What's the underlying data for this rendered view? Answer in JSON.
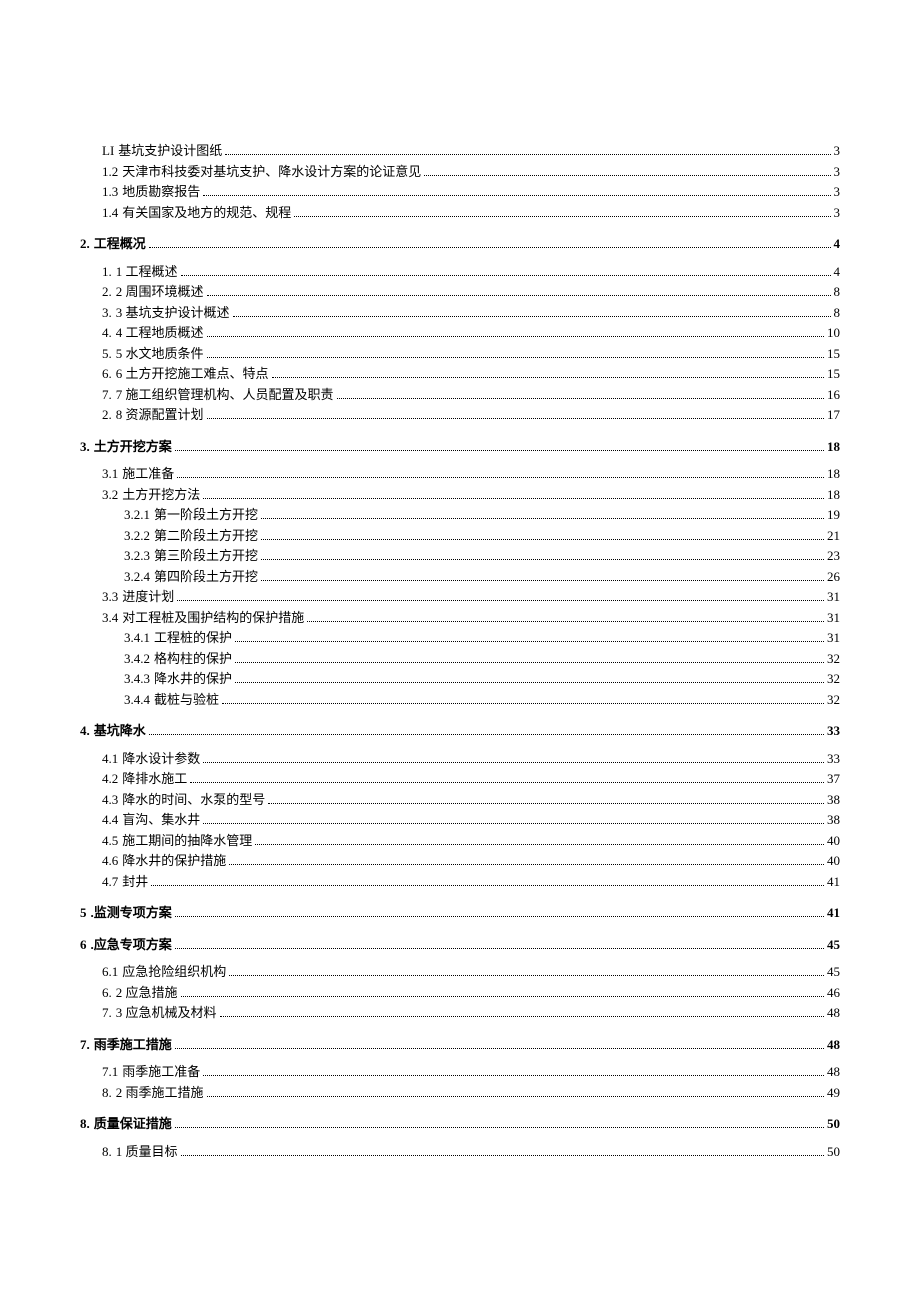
{
  "toc": [
    {
      "level": 2,
      "num": "LI",
      "label": "基坑支护设计图纸",
      "page": "3"
    },
    {
      "level": 2,
      "num": "1.2",
      "label": "天津市科技委对基坑支护、降水设计方案的论证意见",
      "page": "3"
    },
    {
      "level": 2,
      "num": "1.3",
      "label": "地质勘察报告",
      "page": "3"
    },
    {
      "level": 2,
      "num": "1.4",
      "label": "有关国家及地方的规范、规程",
      "page": "3"
    },
    {
      "level": 1,
      "num": "2.",
      "label": "工程概况",
      "page": "4"
    },
    {
      "level": 2,
      "num": "1.",
      "label": "1 工程概述",
      "page": "4"
    },
    {
      "level": 2,
      "num": "2.",
      "label": "2 周围环境概述",
      "page": "8"
    },
    {
      "level": 2,
      "num": "3.",
      "label": "3 基坑支护设计概述",
      "page": "8"
    },
    {
      "level": 2,
      "num": "4.",
      "label": "4 工程地质概述",
      "page": "10"
    },
    {
      "level": 2,
      "num": "5.",
      "label": "5 水文地质条件",
      "page": "15"
    },
    {
      "level": 2,
      "num": "6.",
      "label": "6 土方开挖施工难点、特点",
      "page": "15"
    },
    {
      "level": 2,
      "num": "7.",
      "label": "7 施工组织管理机构、人员配置及职责",
      "page": "16"
    },
    {
      "level": 2,
      "num": "2.",
      "label": "8 资源配置计划",
      "page": "17"
    },
    {
      "level": 1,
      "num": "3.",
      "label": "土方开挖方案",
      "page": "18"
    },
    {
      "level": 2,
      "num": "3.1",
      "label": "施工准备",
      "page": "18"
    },
    {
      "level": 2,
      "num": "3.2",
      "label": "土方开挖方法",
      "page": "18"
    },
    {
      "level": 3,
      "num": "3.2.1",
      "label": "第一阶段土方开挖",
      "page": "19"
    },
    {
      "level": 3,
      "num": "3.2.2",
      "label": "第二阶段土方开挖",
      "page": "21"
    },
    {
      "level": 3,
      "num": "3.2.3",
      "label": "第三阶段土方开挖",
      "page": "23"
    },
    {
      "level": 3,
      "num": "3.2.4",
      "label": "第四阶段土方开挖",
      "page": "26"
    },
    {
      "level": 2,
      "num": "3.3",
      "label": "进度计划",
      "page": "31"
    },
    {
      "level": 2,
      "num": "3.4",
      "label": "对工程桩及围护结构的保护措施",
      "page": "31"
    },
    {
      "level": 3,
      "num": "3.4.1",
      "label": "工程桩的保护",
      "page": "31"
    },
    {
      "level": 3,
      "num": "3.4.2",
      "label": "格构柱的保护",
      "page": "32"
    },
    {
      "level": 3,
      "num": "3.4.3",
      "label": "降水井的保护",
      "page": "32"
    },
    {
      "level": 3,
      "num": "3.4.4",
      "label": "截桩与验桩",
      "page": "32"
    },
    {
      "level": 1,
      "num": "4.",
      "label": "基坑降水",
      "page": "33"
    },
    {
      "level": 2,
      "num": "4.1",
      "label": "降水设计参数",
      "page": "33"
    },
    {
      "level": 2,
      "num": "4.2",
      "label": "降排水施工",
      "page": "37"
    },
    {
      "level": 2,
      "num": "4.3",
      "label": "降水的时间、水泵的型号",
      "page": "38"
    },
    {
      "level": 2,
      "num": "4.4",
      "label": "盲沟、集水井",
      "page": "38"
    },
    {
      "level": 2,
      "num": "4.5",
      "label": "施工期间的抽降水管理",
      "page": "40"
    },
    {
      "level": 2,
      "num": "4.6",
      "label": "降水井的保护措施",
      "page": "40"
    },
    {
      "level": 2,
      "num": "4.7",
      "label": "封井",
      "page": "41"
    },
    {
      "level": 1,
      "num": "5",
      "label": ".监测专项方案",
      "page": "41"
    },
    {
      "level": 1,
      "num": "6",
      "label": ".应急专项方案",
      "page": "45"
    },
    {
      "level": 2,
      "num": "6.1",
      "label": "应急抢险组织机构",
      "page": "45"
    },
    {
      "level": 2,
      "num": "6.",
      "label": "2 应急措施",
      "page": "46"
    },
    {
      "level": 2,
      "num": "7.",
      "label": "3 应急机械及材料",
      "page": "48"
    },
    {
      "level": 1,
      "num": "7.",
      "label": "雨季施工措施",
      "page": "48"
    },
    {
      "level": 2,
      "num": "7.1",
      "label": "雨季施工准备",
      "page": "48"
    },
    {
      "level": 2,
      "num": "8.",
      "label": "2 雨季施工措施",
      "page": "49"
    },
    {
      "level": 1,
      "num": "8.",
      "label": "质量保证措施",
      "page": "50"
    },
    {
      "level": 2,
      "num": "8.",
      "label": "1 质量目标",
      "page": "50"
    }
  ]
}
